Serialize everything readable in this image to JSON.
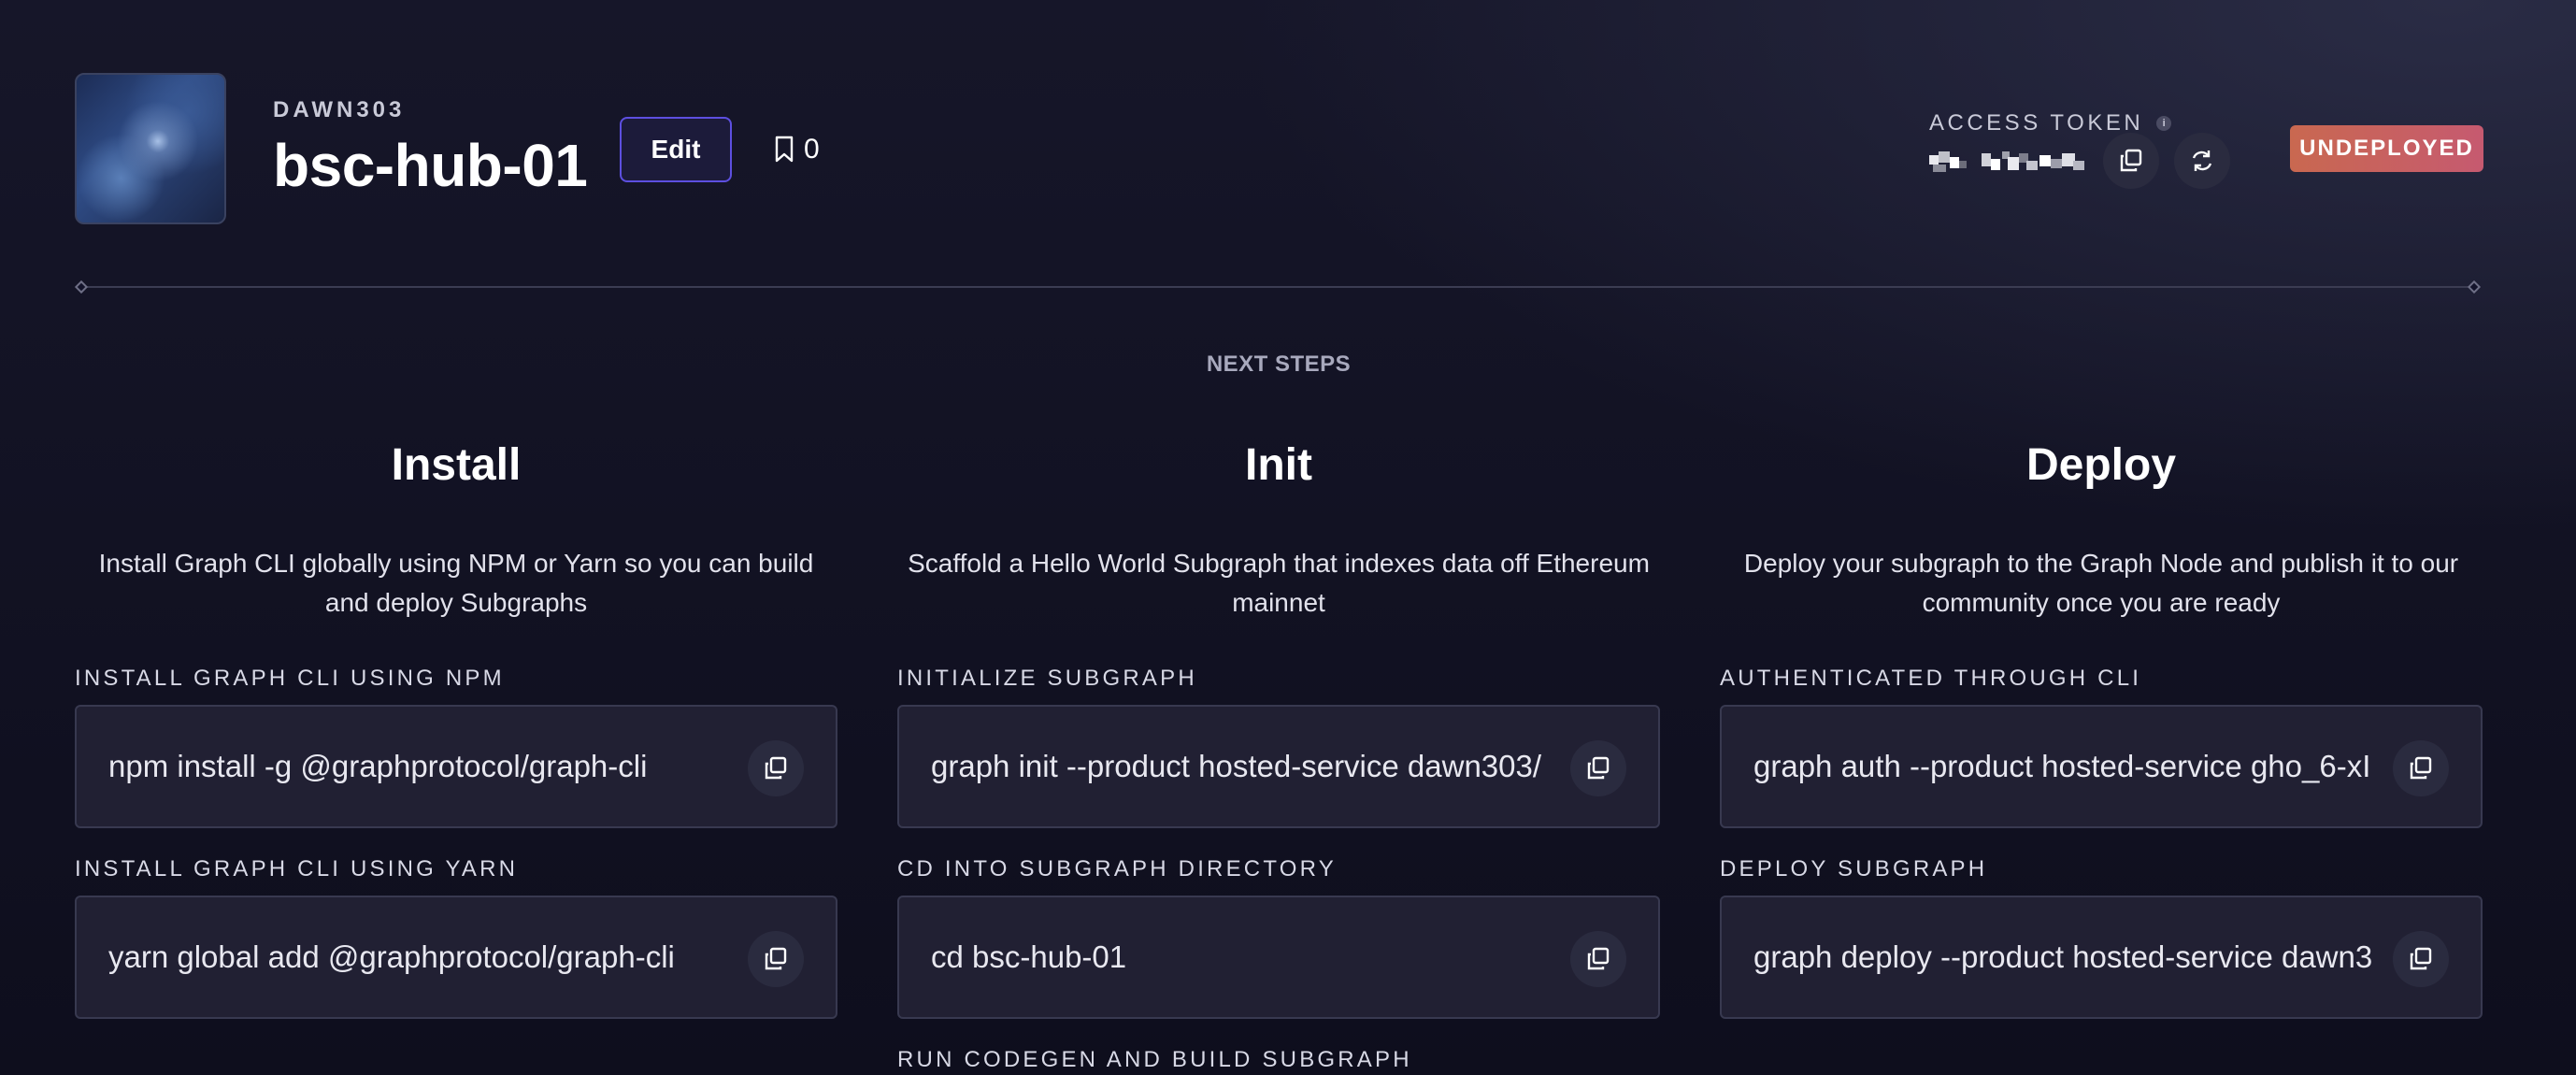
{
  "header": {
    "owner": "DAWN303",
    "title": "bsc-hub-01",
    "edit_label": "Edit",
    "bookmark_count": "0",
    "access_token_label": "ACCESS TOKEN",
    "status_badge": "UNDEPLOYED"
  },
  "next_steps_label": "NEXT STEPS",
  "columns": [
    {
      "title": "Install",
      "description": "Install Graph CLI globally using NPM or Yarn so you can build and deploy Subgraphs",
      "fields": [
        {
          "label": "INSTALL GRAPH CLI USING NPM",
          "command": "npm install -g @graphprotocol/graph-cli"
        },
        {
          "label": "INSTALL GRAPH CLI USING YARN",
          "command": "yarn global add @graphprotocol/graph-cli"
        }
      ]
    },
    {
      "title": "Init",
      "description": "Scaffold a Hello World Subgraph that indexes data off Ethereum mainnet",
      "fields": [
        {
          "label": "INITIALIZE SUBGRAPH",
          "command": "graph init --product hosted-service dawn303/"
        },
        {
          "label": "CD INTO SUBGRAPH DIRECTORY",
          "command": "cd bsc-hub-01"
        },
        {
          "label": "RUN CODEGEN AND BUILD SUBGRAPH",
          "command": ""
        }
      ]
    },
    {
      "title": "Deploy",
      "description": "Deploy your subgraph to the Graph Node and publish it to our community once you are ready",
      "fields": [
        {
          "label": "AUTHENTICATED THROUGH CLI",
          "command": "graph auth --product hosted-service gho_6-xI"
        },
        {
          "label": "DEPLOY SUBGRAPH",
          "command": "graph deploy --product hosted-service dawn3"
        }
      ]
    }
  ],
  "colors": {
    "background": "#13132a",
    "accent_border": "#5d4fe0",
    "badge_gradient_start": "#c96850",
    "badge_gradient_end": "#c65a70",
    "box_background": "#212033"
  },
  "icons": [
    "bookmark-icon",
    "info-icon",
    "copy-icon",
    "refresh-icon"
  ]
}
